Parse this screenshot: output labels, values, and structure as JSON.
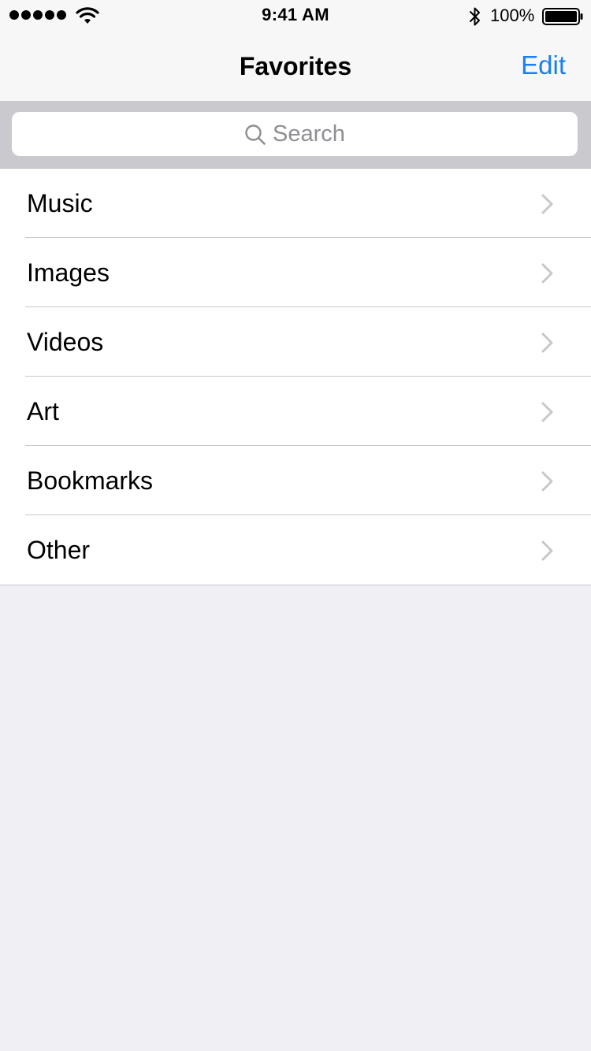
{
  "status_bar": {
    "time": "9:41 AM",
    "battery_percent": "100%"
  },
  "nav": {
    "title": "Favorites",
    "edit_label": "Edit"
  },
  "search": {
    "placeholder": "Search"
  },
  "list": {
    "items": [
      {
        "label": "Music"
      },
      {
        "label": "Images"
      },
      {
        "label": "Videos"
      },
      {
        "label": "Art"
      },
      {
        "label": "Bookmarks"
      },
      {
        "label": "Other"
      }
    ]
  },
  "colors": {
    "accent": "#1a7ff5",
    "background": "#efeff4",
    "search_bar_bg": "#c9c9ce",
    "separator": "#c8c7cc",
    "chevron": "#c7c7cc"
  }
}
